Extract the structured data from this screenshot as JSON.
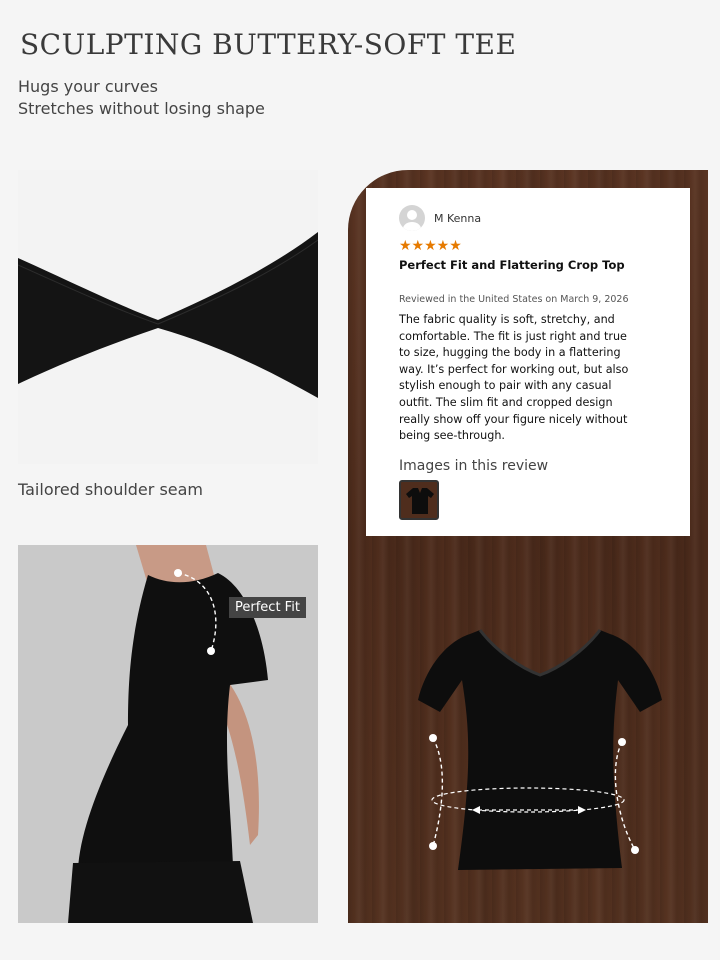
{
  "header": {
    "title": "SCULPTING BUTTERY-SOFT TEE",
    "subtitle_lines": [
      "Hugs your curves",
      "Stretches without losing shape"
    ]
  },
  "seam_panel": {
    "caption": "Tailored shoulder seam"
  },
  "model_panel": {
    "label": "Perfect Fit"
  },
  "review": {
    "reviewer": "M Kenna",
    "rating": 5,
    "stars": "★★★★★",
    "title": "Perfect Fit and Flattering Crop Top",
    "meta": "Reviewed in the United States on March 9, 2026",
    "body": "The fabric quality is soft, stretchy, and comfortable. The fit is just right and true to size, hugging the body in a flattering way. It’s perfect for working out, but also stylish enough to pair with any casual outfit. The slim fit and cropped design really show off your figure nicely without being see-through.",
    "images_heading": "Images in this review"
  },
  "colors": {
    "background": "#f5f5f5",
    "star": "#e67a00",
    "wood": "#4e2c1c",
    "tee": "#0d0d0d"
  }
}
